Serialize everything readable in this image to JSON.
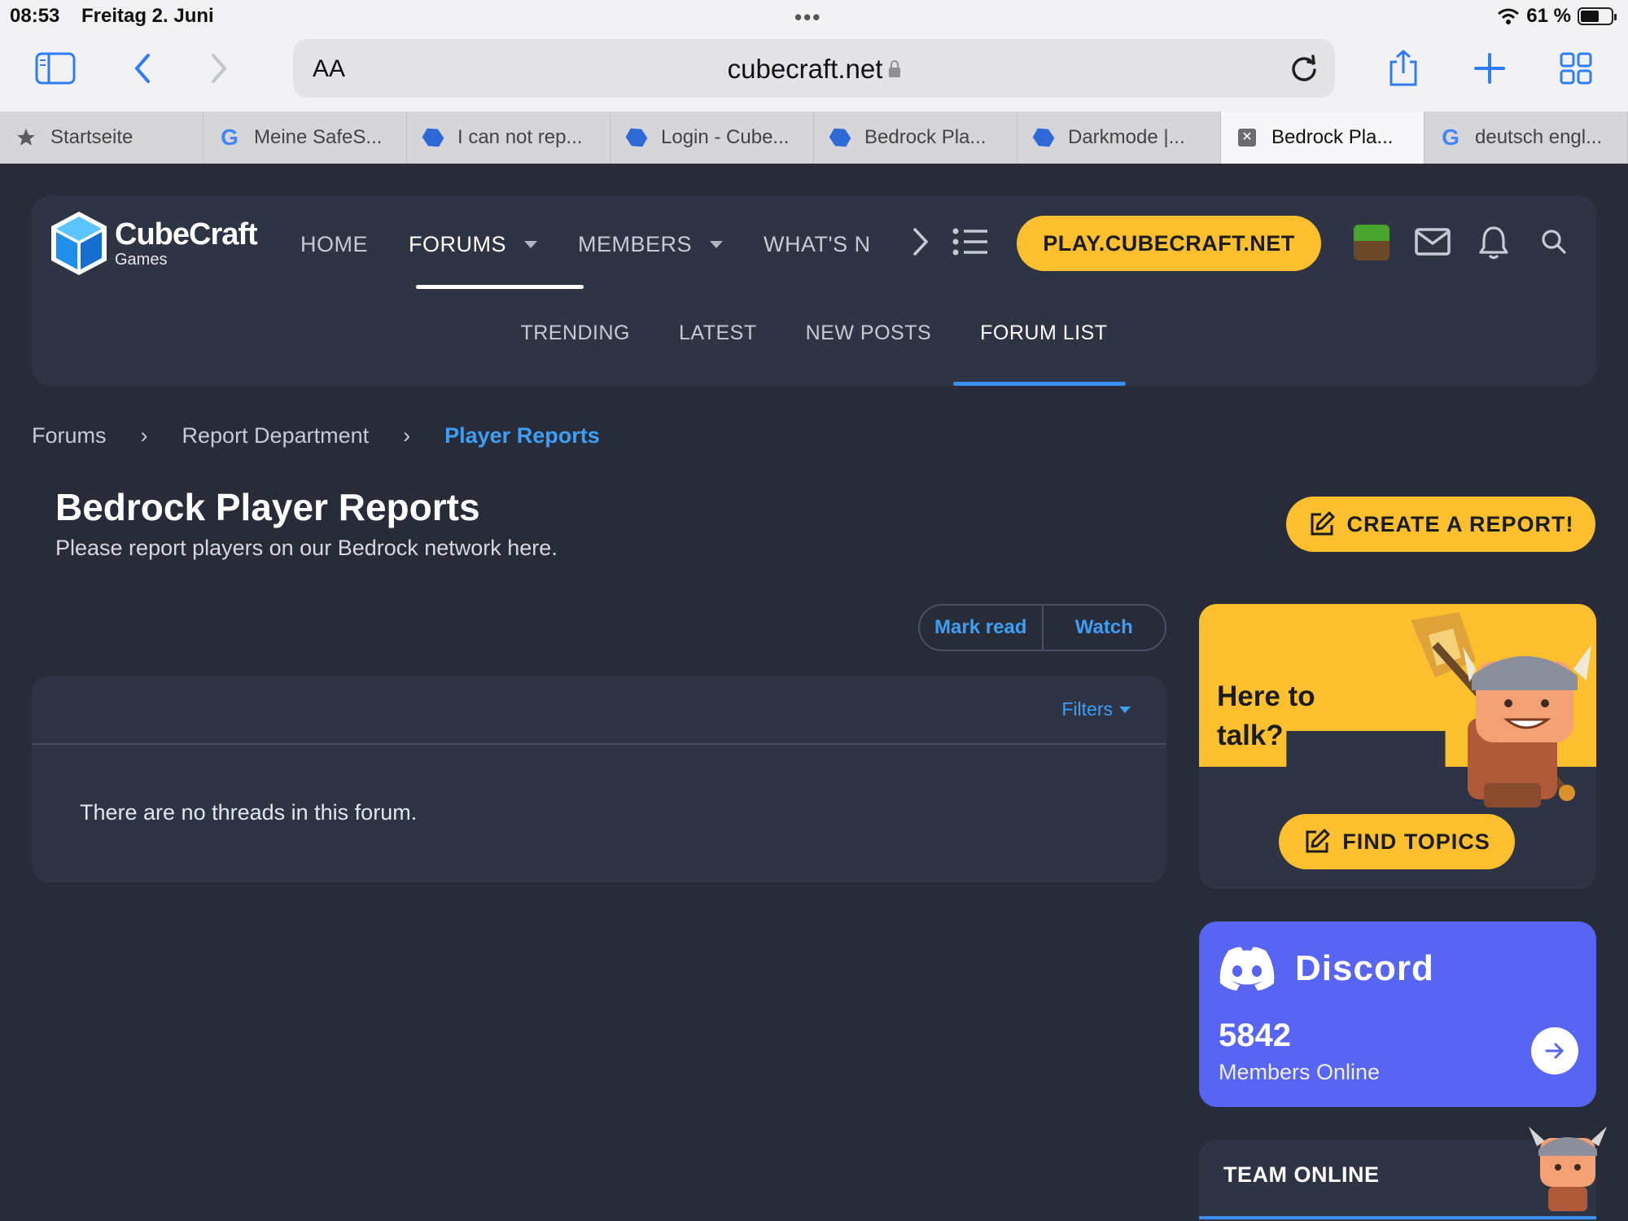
{
  "status_bar": {
    "time": "08:53",
    "date": "Freitag 2. Juni",
    "battery": "61 %",
    "battery_level": 0.61
  },
  "browser": {
    "aa_label": "AA",
    "url": "cubecraft.net",
    "tabs": [
      {
        "label": "Startseite",
        "icon": "star-icon",
        "active": false
      },
      {
        "label": "Meine SafeS...",
        "icon": "google-icon",
        "active": false
      },
      {
        "label": "I can not rep...",
        "icon": "cubecraft-favicon",
        "active": false
      },
      {
        "label": "Login - Cube...",
        "icon": "cubecraft-favicon",
        "active": false
      },
      {
        "label": "Bedrock Pla...",
        "icon": "cubecraft-favicon",
        "active": false
      },
      {
        "label": "Darkmode |...",
        "icon": "cubecraft-favicon",
        "active": false
      },
      {
        "label": "Bedrock Pla...",
        "icon": "close-icon",
        "active": true
      },
      {
        "label": "deutsch engl...",
        "icon": "google-icon",
        "active": false
      }
    ]
  },
  "header": {
    "logo_title": "CubeCraft",
    "logo_subtitle": "Games",
    "nav": [
      "HOME",
      "FORUMS",
      "MEMBERS",
      "WHAT'S N"
    ],
    "play_button": "PLAY.CUBECRAFT.NET",
    "subnav": [
      "TRENDING",
      "LATEST",
      "NEW POSTS",
      "FORUM LIST"
    ]
  },
  "breadcrumb": [
    "Forums",
    "Report Department",
    "Player Reports"
  ],
  "page": {
    "title": "Bedrock Player Reports",
    "description": "Please report players on our Bedrock network here.",
    "create_button": "CREATE A REPORT!",
    "mark_read": "Mark read",
    "watch": "Watch",
    "filters": "Filters",
    "empty_message": "There are no threads in this forum."
  },
  "sidebar": {
    "talk_title_line1": "Here to",
    "talk_title_line2": "talk?",
    "find_topics": "FIND TOPICS",
    "discord_name": "Discord",
    "discord_count": "5842",
    "discord_label": "Members Online",
    "team_online": "TEAM ONLINE"
  },
  "colors": {
    "accent_yellow": "#fcc02e",
    "accent_blue": "#3d9ef5",
    "discord": "#5865f2",
    "background": "#282c39",
    "panel": "#2f3444"
  }
}
